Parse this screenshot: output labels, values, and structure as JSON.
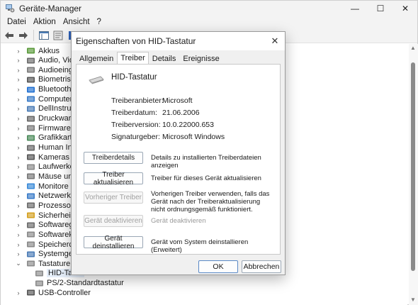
{
  "window": {
    "title": "Geräte-Manager",
    "minimize": "—",
    "maximize": "☐",
    "close": "✕"
  },
  "menu": [
    "Datei",
    "Aktion",
    "Ansicht",
    "?"
  ],
  "toolbar": {
    "icons": [
      "back-arrow-icon",
      "forward-arrow-icon",
      "properties-view-icon",
      "help-book-icon",
      "update-driver-icon",
      "monitor-icon"
    ]
  },
  "tree": {
    "items": [
      {
        "label": "Akkus",
        "icon": "battery",
        "expanded": false
      },
      {
        "label": "Audio, Video",
        "icon": "audio",
        "expanded": false
      },
      {
        "label": "Audioeingäng",
        "icon": "speaker",
        "expanded": false
      },
      {
        "label": "Biometrische",
        "icon": "fingerprint",
        "expanded": false
      },
      {
        "label": "Bluetooth",
        "icon": "bluetooth",
        "expanded": false
      },
      {
        "label": "Computer",
        "icon": "computer",
        "expanded": false
      },
      {
        "label": "DellInstrumen",
        "icon": "instrument",
        "expanded": false
      },
      {
        "label": "Druckwarteso",
        "icon": "printer",
        "expanded": false
      },
      {
        "label": "Firmware",
        "icon": "chip",
        "expanded": false
      },
      {
        "label": "Grafikkarten",
        "icon": "display-adapter",
        "expanded": false
      },
      {
        "label": "Human Interf",
        "icon": "hid",
        "expanded": false
      },
      {
        "label": "Kameras",
        "icon": "camera",
        "expanded": false
      },
      {
        "label": "Laufwerke",
        "icon": "drive",
        "expanded": false
      },
      {
        "label": "Mäuse und a",
        "icon": "mouse",
        "expanded": false
      },
      {
        "label": "Monitore",
        "icon": "monitor",
        "expanded": false
      },
      {
        "label": "Netzwerkada",
        "icon": "network",
        "expanded": false
      },
      {
        "label": "Prozessoren",
        "icon": "cpu",
        "expanded": false
      },
      {
        "label": "Sicherheitsge",
        "icon": "security",
        "expanded": false
      },
      {
        "label": "Softwaregerä",
        "icon": "software",
        "expanded": false
      },
      {
        "label": "Softwarekom",
        "icon": "component",
        "expanded": false
      },
      {
        "label": "Speichercontr",
        "icon": "storage",
        "expanded": false
      },
      {
        "label": "Systemgeräte",
        "icon": "system",
        "expanded": false
      },
      {
        "label": "Tastaturen",
        "icon": "keyboard",
        "expanded": true
      },
      {
        "label": "HID-Tasta",
        "icon": "keyboard",
        "child": true,
        "selected": true
      },
      {
        "label": "PS/2-Standardtastatur",
        "icon": "keyboard",
        "child": true
      },
      {
        "label": "USB-Controller",
        "icon": "usb",
        "expanded": false
      }
    ]
  },
  "dialog": {
    "title": "Eigenschaften von HID-Tastatur",
    "close": "✕",
    "tabs": [
      "Allgemein",
      "Treiber",
      "Details",
      "Ereignisse"
    ],
    "active_tab": 1,
    "device_name": "HID-Tastatur",
    "properties": [
      {
        "label": "Treiberanbieter:",
        "value": "Microsoft"
      },
      {
        "label": "Treiberdatum:",
        "value": "21.06.2006"
      },
      {
        "label": "Treiberversion:",
        "value": "10.0.22000.653"
      },
      {
        "label": "Signaturgeber:",
        "value": "Microsoft Windows"
      }
    ],
    "actions": [
      {
        "button": "Treiberdetails",
        "desc": "Details zu installierten Treiberdateien anzeigen",
        "enabled": true
      },
      {
        "button": "Treiber aktualisieren",
        "desc": "Treiber für dieses Gerät aktualisieren",
        "enabled": true
      },
      {
        "button": "Vorheriger Treiber",
        "desc": "Vorherigen Treiber verwenden, falls das Gerät nach der Treiberaktualisierung nicht ordnungsgemäß funktioniert.",
        "enabled": false
      },
      {
        "button": "Gerät deaktivieren",
        "desc": "Gerät deaktivieren",
        "enabled": false
      },
      {
        "button": "Gerät deinstallieren",
        "desc": "Gerät vom System deinstallieren (Erweitert)",
        "enabled": true
      }
    ],
    "ok": "OK",
    "cancel": "Abbrechen"
  },
  "colors": {
    "accent": "#0067c0",
    "chrome": "#f3f3f3",
    "dialog_bg": "#f0f0f0"
  }
}
